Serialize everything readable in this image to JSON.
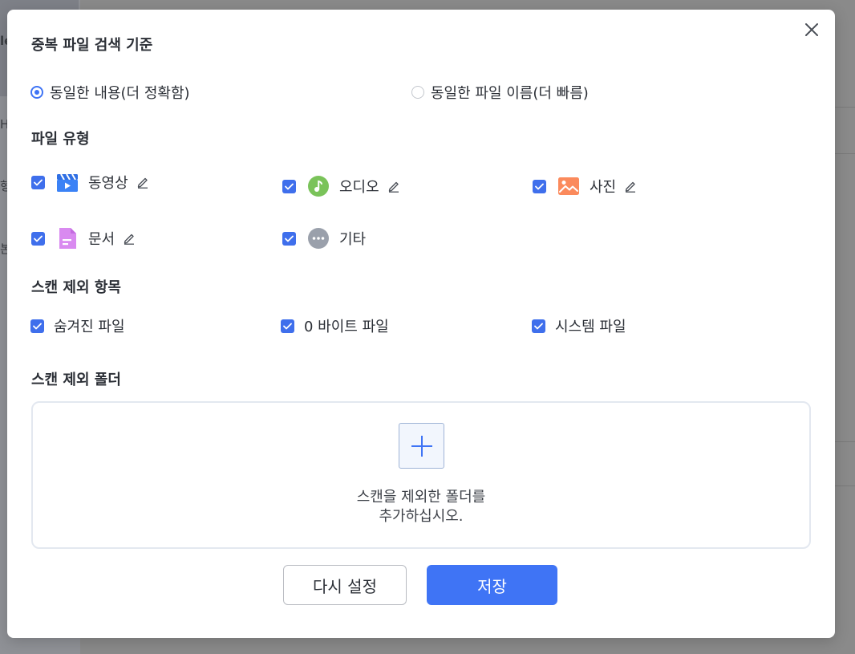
{
  "dialog": {
    "criteria_title": "중복 파일 검색 기준",
    "criteria_options": [
      {
        "label": "동일한 내용(더 정확함)",
        "selected": true
      },
      {
        "label": "동일한 파일 이름(더 빠름)",
        "selected": false
      }
    ],
    "filetype_title": "파일 유형",
    "filetypes": [
      {
        "label": "동영상",
        "icon": "video-clapper-icon",
        "checked": true,
        "editable": true
      },
      {
        "label": "오디오",
        "icon": "music-note-icon",
        "checked": true,
        "editable": true
      },
      {
        "label": "사진",
        "icon": "image-icon",
        "checked": true,
        "editable": true
      },
      {
        "label": "문서",
        "icon": "document-icon",
        "checked": true,
        "editable": true
      },
      {
        "label": "기타",
        "icon": "more-dots-icon",
        "checked": true,
        "editable": false
      }
    ],
    "exclude_title": "스캔 제외 항목",
    "exclude_items": [
      {
        "label": "숨겨진 파일",
        "checked": true
      },
      {
        "label": "0 바이트 파일",
        "checked": true
      },
      {
        "label": "시스템 파일",
        "checked": true
      }
    ],
    "exclude_folder_title": "스캔 제외 폴더",
    "dropzone_hint_line1": "스캔을 제외한 폴더를",
    "dropzone_hint_line2": "추가하십시오.",
    "reset_label": "다시 설정",
    "save_label": "저장"
  },
  "colors": {
    "accent": "#3f74f5",
    "checkbox": "#3f6fec",
    "video": "#3b82f6",
    "audio": "#7ac35a",
    "image": "#fb8a5c",
    "document": "#d98af0",
    "other": "#9aa0ab"
  },
  "background": {
    "edge_chars": [
      "le",
      "H",
      "형",
      "본"
    ]
  }
}
